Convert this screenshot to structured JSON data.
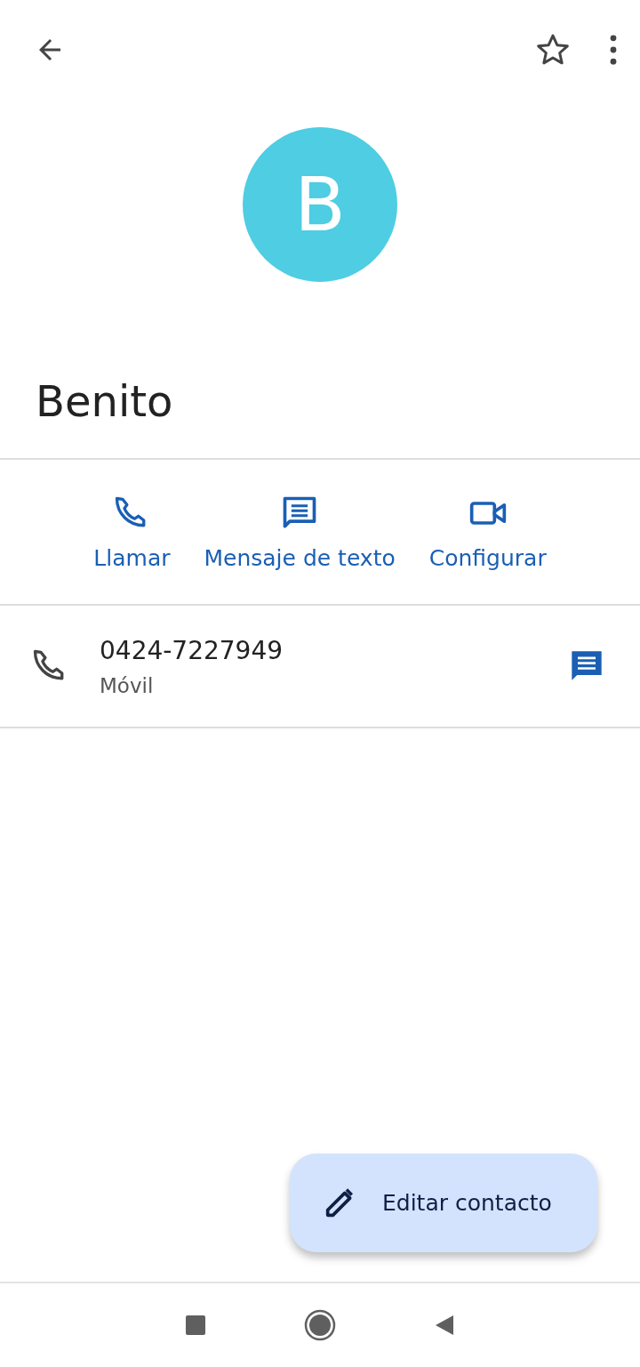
{
  "header": {
    "favorite": false
  },
  "contact": {
    "initial": "B",
    "name": "Benito"
  },
  "actions": [
    {
      "kind": "call",
      "label": "Llamar"
    },
    {
      "kind": "message",
      "label": "Mensaje de texto"
    },
    {
      "kind": "video",
      "label": "Configurar"
    }
  ],
  "phones": [
    {
      "number": "0424-7227949",
      "type": "Móvil"
    }
  ],
  "fab": {
    "label": "Editar contacto"
  }
}
